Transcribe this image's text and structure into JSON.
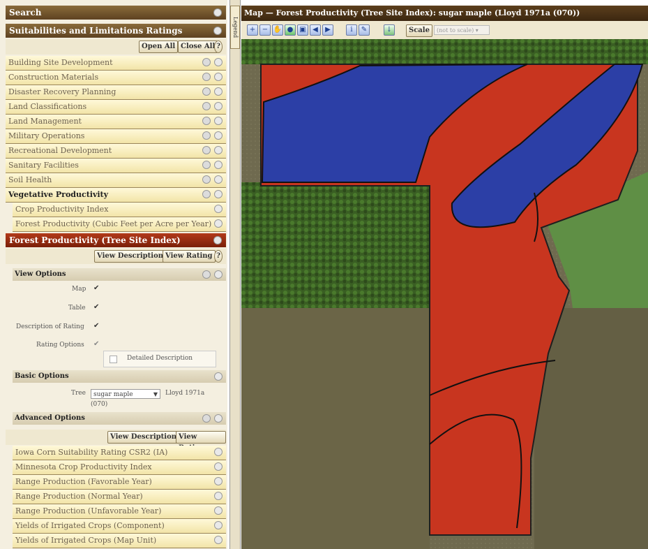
{
  "left_panel": {
    "search_label": "Search",
    "suitabilities_label": "Suitabilities and Limitations Ratings",
    "open_all": "Open All",
    "close_all": "Close All",
    "categories": [
      "Building Site Development",
      "Construction Materials",
      "Disaster Recovery Planning",
      "Land Classifications",
      "Land Management",
      "Military Operations",
      "Recreational Development",
      "Sanitary Facilities",
      "Soil Health",
      "Vegetative Productivity"
    ],
    "veg_items": [
      "Crop Productivity Index",
      "Forest Productivity (Cubic Feet per Acre per Year)"
    ],
    "selected_item": "Forest Productivity (Tree Site Index)",
    "view_description": "View Description",
    "view_rating": "View Rating",
    "view_options_label": "View Options",
    "options": {
      "map": "Map",
      "table": "Table",
      "description_of_rating": "Description of Rating",
      "rating_options": "Rating Options",
      "detailed_description": "Detailed Description"
    },
    "basic_options_label": "Basic Options",
    "tree_label": "Tree",
    "tree_value": "sugar maple",
    "tree_ref": "Lloyd 1971a",
    "tree_code": "(070)",
    "advanced_options_label": "Advanced Options",
    "more_items": [
      "Iowa Corn Suitability Rating CSR2 (IA)",
      "Minnesota Crop Productivity Index",
      "Range Production (Favorable Year)",
      "Range Production (Normal Year)",
      "Range Production (Unfavorable Year)",
      "Yields of Irrigated Crops (Component)",
      "Yields of Irrigated Crops (Map Unit)"
    ]
  },
  "legend_label": "Legend",
  "map": {
    "title": "Map — Forest Productivity (Tree Site Index): sugar maple (Lloyd 1971a (070))",
    "scale_button": "Scale",
    "scale_select": "(not to scale)"
  },
  "colors": {
    "dark_header": "#5c3f1d",
    "selected_red": "#9c2b10",
    "map_red": "#c8351f",
    "map_blue": "#2c3fa6",
    "forest_green": "#3f6b2a"
  }
}
